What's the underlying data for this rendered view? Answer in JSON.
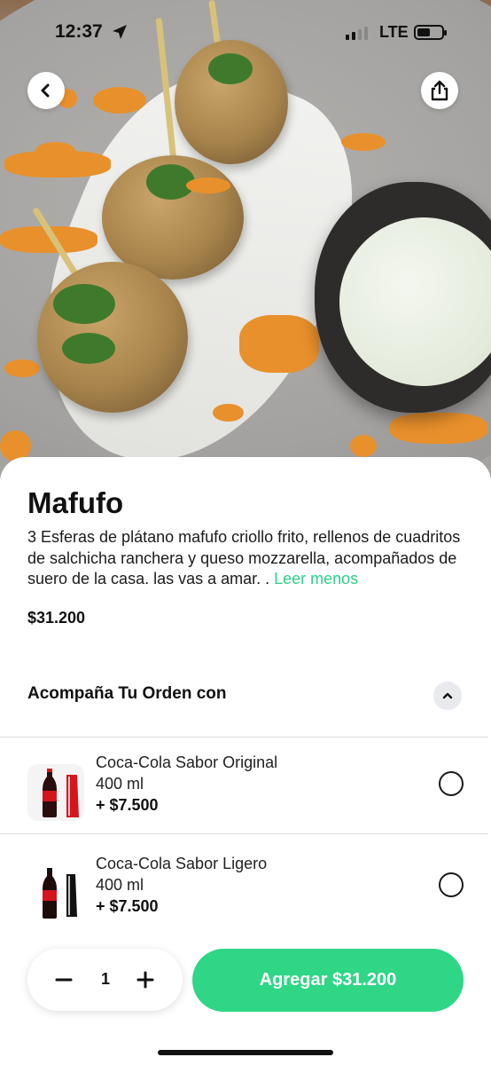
{
  "status_bar": {
    "time": "12:37",
    "network": "LTE",
    "battery_level": 0.5,
    "signal_bars": 2
  },
  "nav": {
    "back_icon": "chevron-left-icon",
    "share_icon": "share-icon"
  },
  "product": {
    "name": "Mafufo",
    "description": "3 Esferas de plátano mafufo criollo frito, rellenos de cuadritos de salchicha ranchera y queso mozzarella, acompañados  de suero de la casa. las vas a amar. . ",
    "read_less": "Leer menos",
    "price": "$31.200"
  },
  "addons": {
    "title": "Acompaña Tu Orden con",
    "toggle_icon": "chevron-up-icon",
    "items": [
      {
        "name": "Coca-Cola Sabor Original",
        "size": "400 ml",
        "price": "+ $7.500",
        "selected": false
      },
      {
        "name": "Coca-Cola Sabor Ligero",
        "size": "400 ml",
        "price": "+ $7.500",
        "selected": false
      }
    ]
  },
  "cart": {
    "quantity": "1",
    "add_label": "Agregar $31.200"
  },
  "colors": {
    "accent": "#2ed686",
    "link": "#2dd186",
    "text": "#111111"
  }
}
